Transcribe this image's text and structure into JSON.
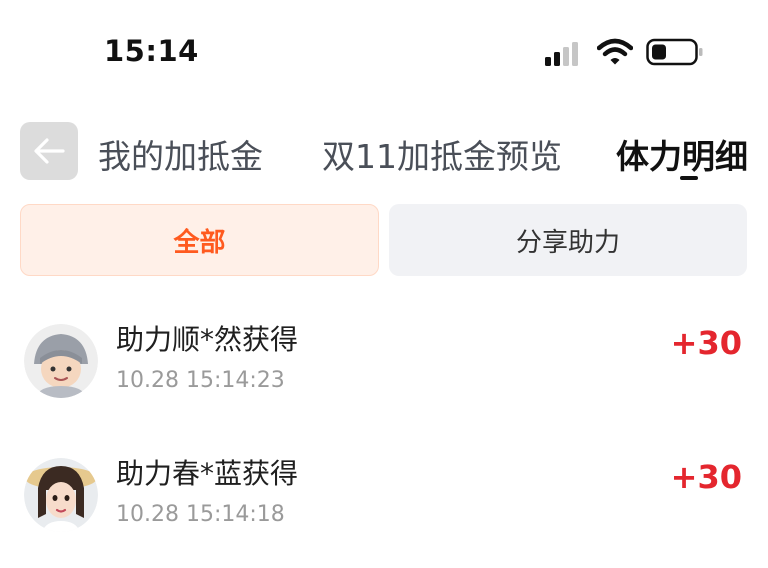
{
  "status_bar": {
    "time": "15:14"
  },
  "tabs": [
    {
      "label": "我的加抵金",
      "active": false
    },
    {
      "label": "双11加抵金预览",
      "active": false
    },
    {
      "label": "体力明细",
      "active": true
    }
  ],
  "filters": [
    {
      "label": "全部",
      "selected": true
    },
    {
      "label": "分享助力",
      "selected": false
    }
  ],
  "records": [
    {
      "title": "助力顺*然获得",
      "time": "10.28 15:14:23",
      "points": "+30"
    },
    {
      "title": "助力春*蓝获得",
      "time": "10.28 15:14:18",
      "points": "+30"
    }
  ],
  "colors": {
    "accent": "#ff5a1f",
    "points": "#e4262e",
    "active_filter_bg": "#fff0e8",
    "inactive_filter_bg": "#f1f2f5"
  }
}
